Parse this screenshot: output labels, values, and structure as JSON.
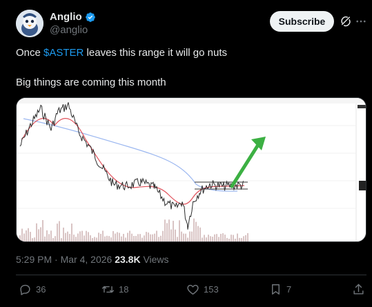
{
  "author": {
    "display_name": "Anglio",
    "handle": "@anglio",
    "verified": true
  },
  "header": {
    "subscribe_label": "Subscribe",
    "grok_icon": "grok-icon",
    "more_icon": "more-icon"
  },
  "post": {
    "line1_prefix": "Once ",
    "cashtag": "$ASTER",
    "line1_suffix": " leaves this range it will go nuts",
    "line2": "Big things are coming this month"
  },
  "media": {
    "type": "price-chart-image",
    "accent_colors": {
      "price": "#2b2b2b",
      "ma_fast": "#e0505a",
      "ma_slow": "#9bb7f0",
      "arrow": "#3cb043"
    }
  },
  "meta": {
    "time": "5:29 PM",
    "separator": " · ",
    "date": "Mar 4, 2026",
    "views_count": "23.8K",
    "views_label": " Views"
  },
  "actions": {
    "replies": "36",
    "reposts": "18",
    "likes": "153",
    "bookmarks": "7"
  },
  "colors": {
    "background": "#000000",
    "text": "#e7e9ea",
    "muted": "#71767b",
    "link": "#1d9bf0",
    "verified": "#1d9bf0"
  }
}
